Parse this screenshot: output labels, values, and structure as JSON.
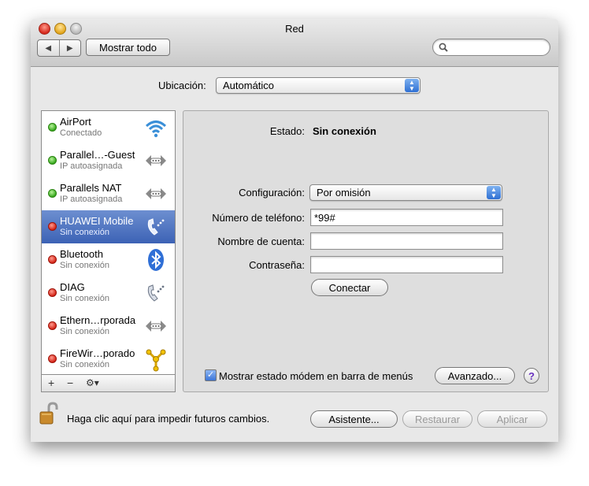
{
  "window": {
    "title": "Red"
  },
  "toolbar": {
    "back": "◀",
    "forward": "▶",
    "show_all": "Mostrar todo",
    "search_placeholder": ""
  },
  "location": {
    "label": "Ubicación:",
    "value": "Automático"
  },
  "services": [
    {
      "name": "AirPort",
      "status": "Conectado",
      "dot": "green",
      "icon": "wifi-icon"
    },
    {
      "name": "Parallel…-Guest",
      "status": "IP autoasignada",
      "dot": "green",
      "icon": "ethernet-icon"
    },
    {
      "name": "Parallels NAT",
      "status": "IP autoasignada",
      "dot": "green",
      "icon": "ethernet-icon"
    },
    {
      "name": "HUAWEI Mobile",
      "status": "Sin conexión",
      "dot": "red",
      "icon": "modem-phone-icon",
      "selected": true
    },
    {
      "name": "Bluetooth",
      "status": "Sin conexión",
      "dot": "red",
      "icon": "bluetooth-icon"
    },
    {
      "name": "DIAG",
      "status": "Sin conexión",
      "dot": "red",
      "icon": "modem-phone-icon"
    },
    {
      "name": "Ethern…rporada",
      "status": "Sin conexión",
      "dot": "red",
      "icon": "ethernet-icon"
    },
    {
      "name": "FireWir…porado",
      "status": "Sin conexión",
      "dot": "red",
      "icon": "firewire-icon"
    }
  ],
  "sidebar_tools": {
    "add": "+",
    "remove": "−",
    "gear": "⚙▾"
  },
  "detail": {
    "status_label": "Estado:",
    "status_value": "Sin conexión",
    "config_label": "Configuración:",
    "config_value": "Por omisión",
    "phone_label": "Número de teléfono:",
    "phone_value": "*99#",
    "account_label": "Nombre de cuenta:",
    "account_value": "",
    "password_label": "Contraseña:",
    "password_value": "",
    "connect_button": "Conectar",
    "show_modem_label": "Mostrar estado módem en barra de menús",
    "show_modem_checked": true,
    "advanced_button": "Avanzado...",
    "help": "?"
  },
  "footer": {
    "lock_text": "Haga clic aquí para impedir futuros cambios.",
    "assistant_button": "Asistente...",
    "revert_button": "Restaurar",
    "apply_button": "Aplicar"
  },
  "colors": {
    "selection": "#3c62b5",
    "status_green": "#2ea315",
    "status_red": "#d11d10"
  }
}
